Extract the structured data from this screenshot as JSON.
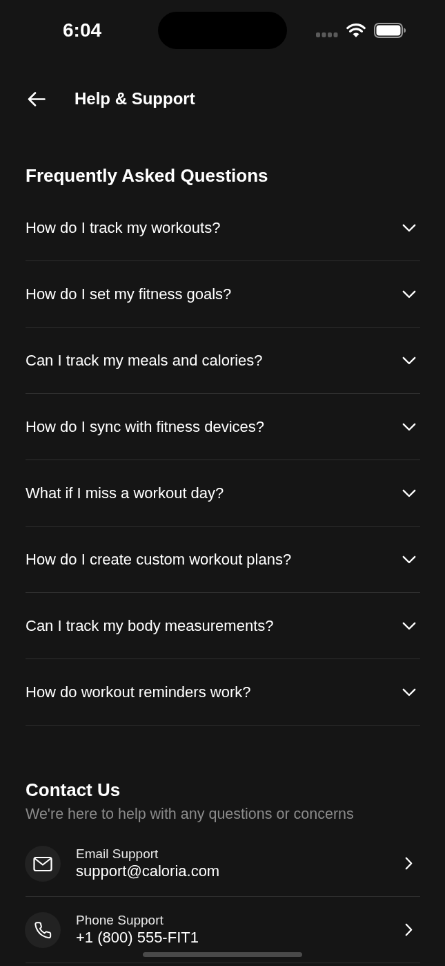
{
  "status_bar": {
    "time": "6:04"
  },
  "header": {
    "title": "Help & Support"
  },
  "faq": {
    "title": "Frequently Asked Questions",
    "items": [
      {
        "question": "How do I track my workouts?",
        "expanded": false
      },
      {
        "question": "How do I set my fitness goals?",
        "expanded": false
      },
      {
        "question": "Can I track my meals and calories?",
        "expanded": false
      },
      {
        "question": "How do I sync with fitness devices?",
        "expanded": false
      },
      {
        "question": "What if I miss a workout day?",
        "expanded": false
      },
      {
        "question": "How do I create custom workout plans?",
        "expanded": false
      },
      {
        "question": "Can I track my body measurements?",
        "expanded": false
      },
      {
        "question": "How do workout reminders work?",
        "expanded": false
      }
    ]
  },
  "contact": {
    "title": "Contact Us",
    "subtitle": "We're here to help with any questions or concerns",
    "items": [
      {
        "kind": "email",
        "label": "Email Support",
        "value": "support@caloria.com"
      },
      {
        "kind": "phone",
        "label": "Phone Support",
        "value": "+1 (800) 555-FIT1"
      }
    ]
  }
}
